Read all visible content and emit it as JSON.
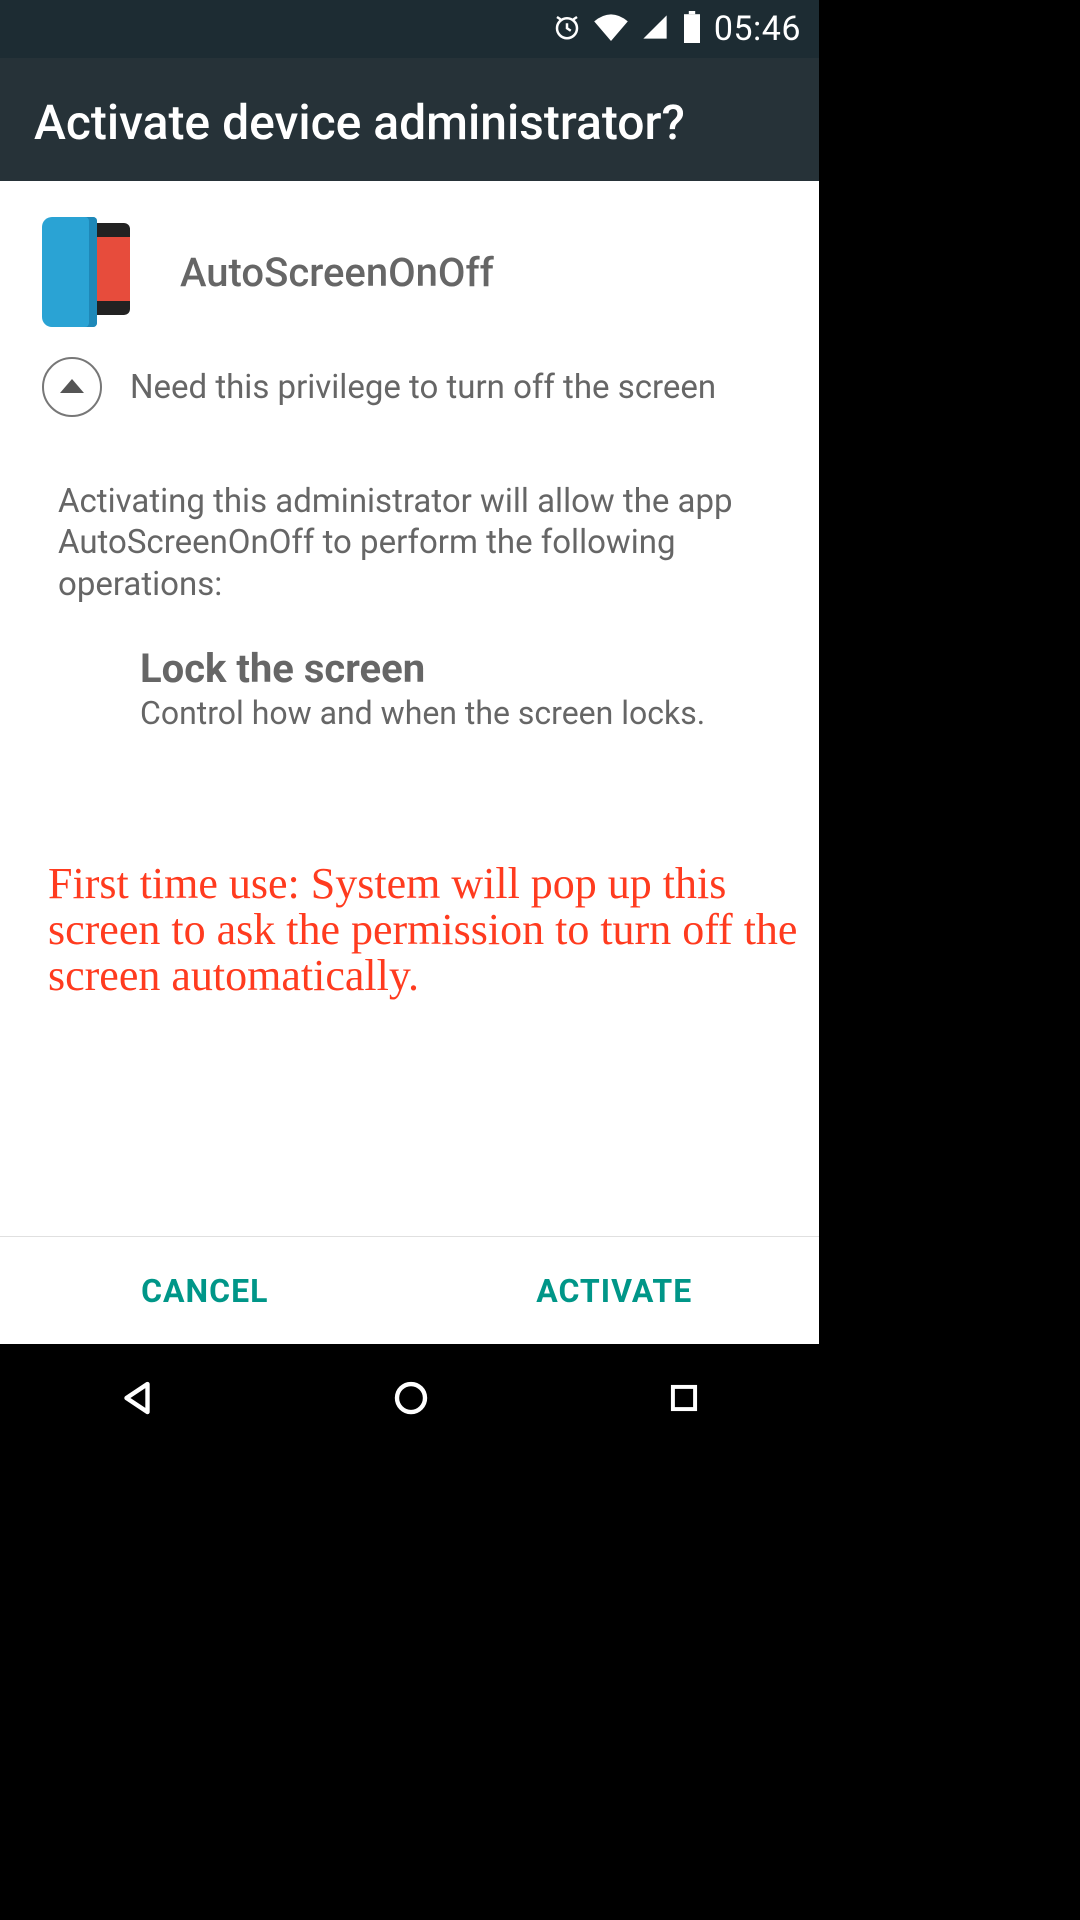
{
  "status": {
    "time": "05:46"
  },
  "header": {
    "title": "Activate device administrator?"
  },
  "app": {
    "name": "AutoScreenOnOff",
    "privilege_note": "Need this privilege to turn off the screen"
  },
  "description": "Activating this administrator will allow the app AutoScreenOnOff to perform the following operations:",
  "permission": {
    "title": "Lock the screen",
    "desc": "Control how and when the screen locks."
  },
  "annotation": "First time use: System will pop up this screen to ask the permission to turn off the screen automatically.",
  "buttons": {
    "cancel": "CANCEL",
    "activate": "ACTIVATE"
  },
  "icons": {
    "alarm": "alarm-icon",
    "wifi": "wifi-icon",
    "cell": "cell-signal-icon",
    "battery": "battery-icon",
    "back": "back-icon",
    "home": "home-icon",
    "recents": "recents-icon",
    "expand_up": "chevron-up-icon"
  },
  "colors": {
    "accent": "#009688",
    "status_bg": "#1d2c33",
    "header_bg": "#263238",
    "annotation": "#ff3b1f"
  }
}
